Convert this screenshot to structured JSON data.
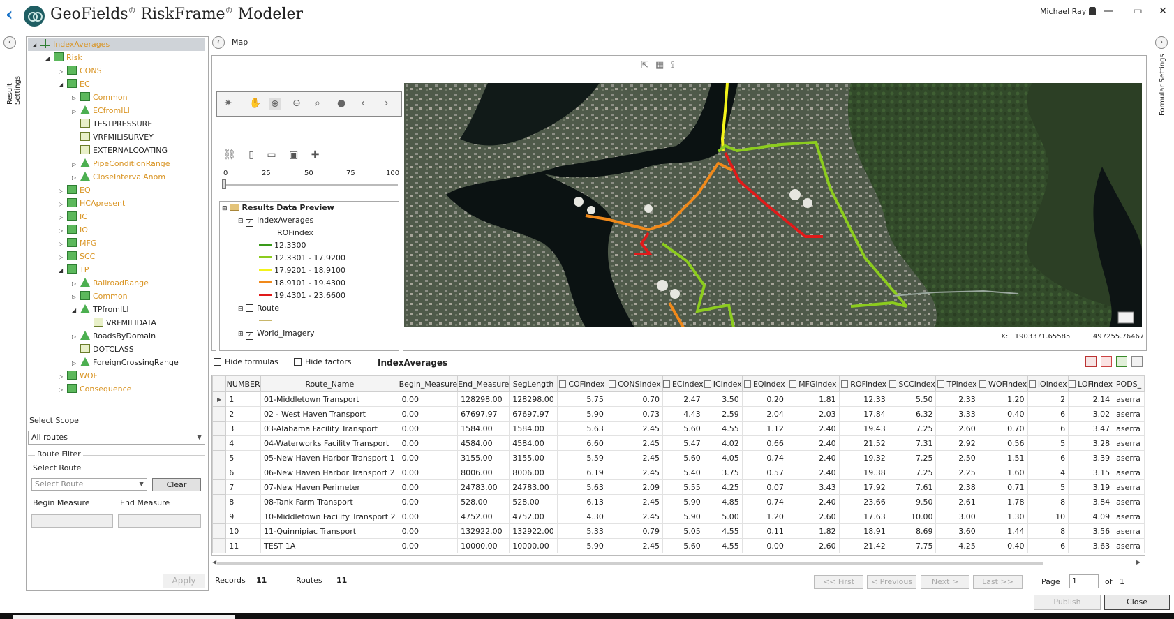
{
  "app": {
    "title": "GeoFields",
    "title2": "RiskFrame",
    "title3": "Modeler",
    "reg": "®",
    "user": "Michael Ray",
    "min": "—",
    "max": "▭",
    "close": "✕"
  },
  "sidetabs": {
    "left": "Result Settings",
    "right": "Formular Settings"
  },
  "tree": [
    {
      "label": "IndexAverages",
      "level": 0,
      "icon": "root",
      "color": "o",
      "expand": "◢",
      "selected": true
    },
    {
      "label": "Risk",
      "level": 1,
      "icon": "cube",
      "color": "o",
      "expand": "◢"
    },
    {
      "label": "CONS",
      "level": 2,
      "icon": "cube",
      "color": "o",
      "expand": "▷"
    },
    {
      "label": "EC",
      "level": 2,
      "icon": "cube",
      "color": "o",
      "expand": "◢"
    },
    {
      "label": "Common",
      "level": 3,
      "icon": "cube",
      "color": "o",
      "expand": "▷"
    },
    {
      "label": "ECfromILI",
      "level": 3,
      "icon": "tri",
      "color": "o",
      "expand": "▷"
    },
    {
      "label": "TESTPRESSURE",
      "level": 3,
      "icon": "tbl",
      "color": "d",
      "expand": ""
    },
    {
      "label": "VRFMILISURVEY",
      "level": 3,
      "icon": "tbl",
      "color": "d",
      "expand": ""
    },
    {
      "label": "EXTERNALCOATING",
      "level": 3,
      "icon": "tbl",
      "color": "d",
      "expand": ""
    },
    {
      "label": "PipeConditionRange",
      "level": 3,
      "icon": "tri",
      "color": "o",
      "expand": "▷"
    },
    {
      "label": "CloseIntervalAnom",
      "level": 3,
      "icon": "tri",
      "color": "o",
      "expand": "▷"
    },
    {
      "label": "EQ",
      "level": 2,
      "icon": "cube",
      "color": "o",
      "expand": "▷"
    },
    {
      "label": "HCApresent",
      "level": 2,
      "icon": "cube",
      "color": "o",
      "expand": "▷"
    },
    {
      "label": "IC",
      "level": 2,
      "icon": "cube",
      "color": "o",
      "expand": "▷"
    },
    {
      "label": "IO",
      "level": 2,
      "icon": "cube",
      "color": "o",
      "expand": "▷"
    },
    {
      "label": "MFG",
      "level": 2,
      "icon": "cube",
      "color": "o",
      "expand": "▷"
    },
    {
      "label": "SCC",
      "level": 2,
      "icon": "cube",
      "color": "o",
      "expand": "▷"
    },
    {
      "label": "TP",
      "level": 2,
      "icon": "cube",
      "color": "o",
      "expand": "◢"
    },
    {
      "label": "RailroadRange",
      "level": 3,
      "icon": "tri",
      "color": "o",
      "expand": "▷"
    },
    {
      "label": "Common",
      "level": 3,
      "icon": "cube",
      "color": "o",
      "expand": "▷"
    },
    {
      "label": "TPfromILI",
      "level": 3,
      "icon": "tri",
      "color": "d",
      "expand": "◢"
    },
    {
      "label": "VRFMILIDATA",
      "level": 4,
      "icon": "tbl",
      "color": "d",
      "expand": ""
    },
    {
      "label": "RoadsByDomain",
      "level": 3,
      "icon": "tri",
      "color": "d",
      "expand": "▷"
    },
    {
      "label": "DOTCLASS",
      "level": 3,
      "icon": "tbl",
      "color": "d",
      "expand": ""
    },
    {
      "label": "ForeignCrossingRange",
      "level": 3,
      "icon": "tri",
      "color": "d",
      "expand": "▷"
    },
    {
      "label": "WOF",
      "level": 2,
      "icon": "cube",
      "color": "o",
      "expand": "▷"
    },
    {
      "label": "Consequence",
      "level": 2,
      "icon": "cube",
      "color": "o",
      "expand": "▷"
    }
  ],
  "filter": {
    "scope_label": "Select Scope",
    "scope_value": "All routes",
    "route_filter": "Route Filter",
    "select_route_label": "Select Route",
    "select_route_placeholder": "Select Route",
    "clear": "Clear",
    "begin_label": "Begin Measure",
    "end_label": "End Measure",
    "apply": "Apply"
  },
  "map": {
    "header": "Map",
    "slider_ticks": [
      "0",
      "25",
      "50",
      "75",
      "100"
    ],
    "slider_value": 0,
    "legend_title": "Results Data Preview",
    "layer1": "IndexAverages",
    "field": "ROFindex",
    "classes": [
      {
        "label": "12.3300",
        "color": "#3a9a1a"
      },
      {
        "label": "12.3301 - 17.9200",
        "color": "#8ccc1e"
      },
      {
        "label": "17.9201 - 18.9100",
        "color": "#f3f31a"
      },
      {
        "label": "18.9101 - 19.4300",
        "color": "#f0891a"
      },
      {
        "label": "19.4301 - 23.6600",
        "color": "#e01a1a"
      }
    ],
    "layer2": "Route",
    "layer3": "World_Imagery",
    "x_label": "X:",
    "x_value": "1903371.65585",
    "y_value": "497255.76467"
  },
  "grid": {
    "hide_formulas": "Hide formulas",
    "hide_factors": "Hide factors",
    "title": "IndexAverages",
    "columns": [
      "NUMBER",
      "Route_Name",
      "Begin_Measure",
      "End_Measure",
      "SegLength",
      "COFindex",
      "CONSindex",
      "ECindex",
      "ICindex",
      "EQindex",
      "MFGindex",
      "ROFindex",
      "SCCindex",
      "TPindex",
      "WOFindex",
      "IOindex",
      "LOFindex",
      "PODS_"
    ],
    "rows": [
      [
        "1",
        "01-Middletown Transport",
        "0.00",
        "128298.00",
        "128298.00",
        "5.75",
        "0.70",
        "2.47",
        "3.50",
        "0.20",
        "1.81",
        "12.33",
        "5.50",
        "2.33",
        "1.20",
        "2",
        "2.14",
        "aserra"
      ],
      [
        "2",
        "02 - West Haven Transport",
        "0.00",
        "67697.97",
        "67697.97",
        "5.90",
        "0.73",
        "4.43",
        "2.59",
        "2.04",
        "2.03",
        "17.84",
        "6.32",
        "3.33",
        "0.40",
        "6",
        "3.02",
        "aserra"
      ],
      [
        "3",
        "03-Alabama Facility Transport",
        "0.00",
        "1584.00",
        "1584.00",
        "5.63",
        "2.45",
        "5.60",
        "4.55",
        "1.12",
        "2.40",
        "19.43",
        "7.25",
        "2.60",
        "0.70",
        "6",
        "3.47",
        "aserra"
      ],
      [
        "4",
        "04-Waterworks Facility Transport",
        "0.00",
        "4584.00",
        "4584.00",
        "6.60",
        "2.45",
        "5.47",
        "4.02",
        "0.66",
        "2.40",
        "21.52",
        "7.31",
        "2.92",
        "0.56",
        "5",
        "3.28",
        "aserra"
      ],
      [
        "5",
        "05-New Haven Harbor Transport 1",
        "0.00",
        "3155.00",
        "3155.00",
        "5.59",
        "2.45",
        "5.60",
        "4.05",
        "0.74",
        "2.40",
        "19.32",
        "7.25",
        "2.50",
        "1.51",
        "6",
        "3.39",
        "aserra"
      ],
      [
        "6",
        "06-New Haven Harbor Transport 2",
        "0.00",
        "8006.00",
        "8006.00",
        "6.19",
        "2.45",
        "5.40",
        "3.75",
        "0.57",
        "2.40",
        "19.38",
        "7.25",
        "2.25",
        "1.60",
        "4",
        "3.15",
        "aserra"
      ],
      [
        "7",
        "07-New Haven Perimeter",
        "0.00",
        "24783.00",
        "24783.00",
        "5.63",
        "2.09",
        "5.55",
        "4.25",
        "0.07",
        "3.43",
        "17.92",
        "7.61",
        "2.38",
        "0.71",
        "5",
        "3.19",
        "aserra"
      ],
      [
        "8",
        "08-Tank Farm Transport",
        "0.00",
        "528.00",
        "528.00",
        "6.13",
        "2.45",
        "5.90",
        "4.85",
        "0.74",
        "2.40",
        "23.66",
        "9.50",
        "2.61",
        "1.78",
        "8",
        "3.84",
        "aserra"
      ],
      [
        "9",
        "10-Middletown Facility Transport 2",
        "0.00",
        "4752.00",
        "4752.00",
        "4.30",
        "2.45",
        "5.90",
        "5.00",
        "1.20",
        "2.60",
        "17.63",
        "10.00",
        "3.00",
        "1.30",
        "10",
        "4.09",
        "aserra"
      ],
      [
        "10",
        "11-Quinnipiac Transport",
        "0.00",
        "132922.00",
        "132922.00",
        "5.33",
        "0.79",
        "5.05",
        "4.55",
        "0.11",
        "1.82",
        "18.91",
        "8.69",
        "3.60",
        "1.44",
        "8",
        "3.56",
        "aserra"
      ],
      [
        "11",
        "TEST 1A",
        "0.00",
        "10000.00",
        "10000.00",
        "5.90",
        "2.45",
        "5.60",
        "4.55",
        "0.00",
        "2.60",
        "21.42",
        "7.75",
        "4.25",
        "0.40",
        "6",
        "3.63",
        "aserra"
      ]
    ]
  },
  "footer": {
    "records_label": "Records",
    "records_value": "11",
    "routes_label": "Routes",
    "routes_value": "11",
    "first": "<< First",
    "previous": "< Previous",
    "next": "Next >",
    "last": "Last >>",
    "page_label": "Page",
    "page_value": "1",
    "of_label": "of",
    "of_value": "1",
    "publish": "Publish",
    "close": "Close"
  }
}
